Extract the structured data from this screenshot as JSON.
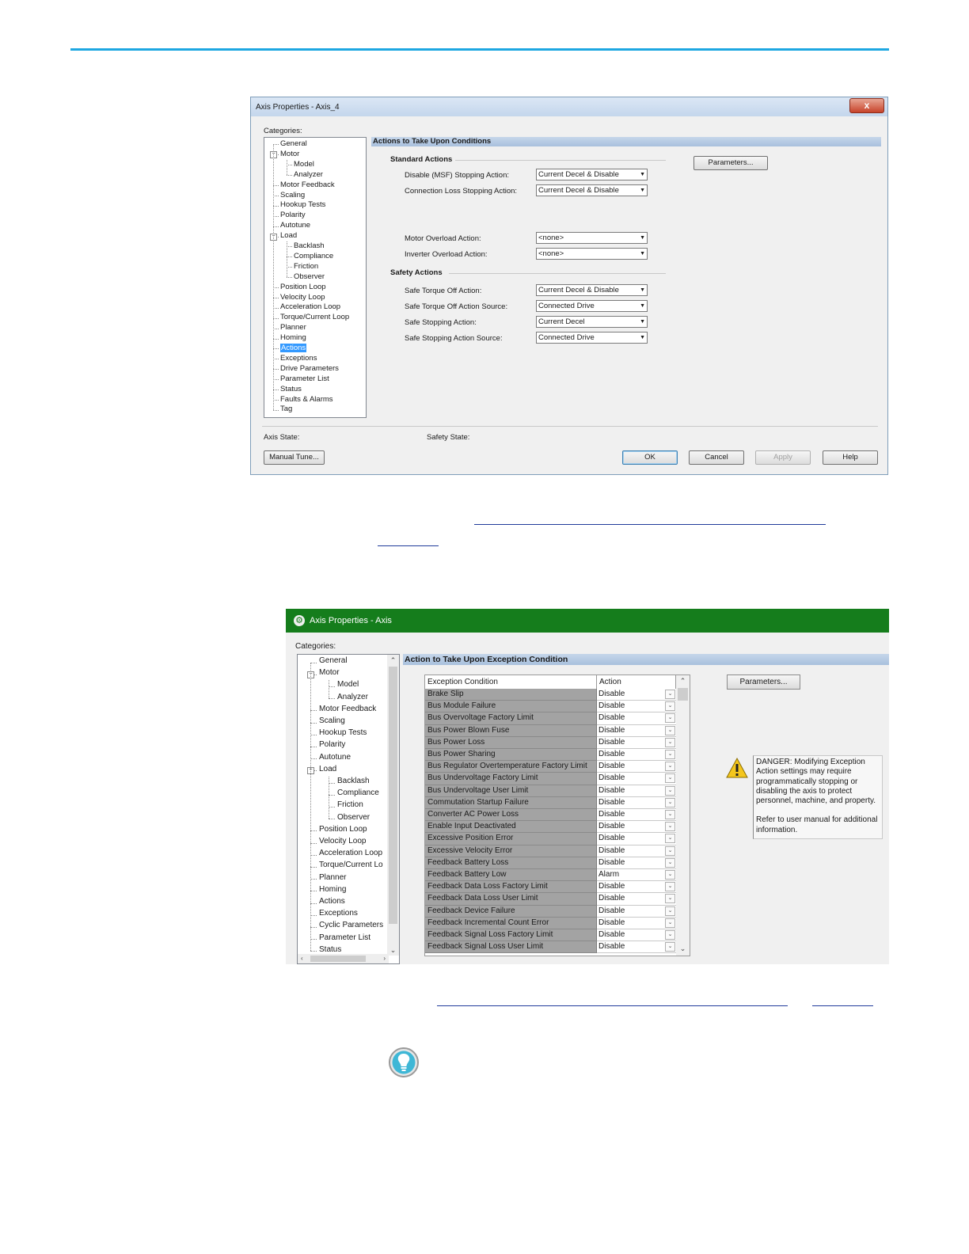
{
  "dialog1": {
    "title": "Axis Properties - Axis_4",
    "close_label": "x",
    "categories_label": "Categories:",
    "tree": [
      "General",
      "Motor",
      "Model",
      "Analyzer",
      "Motor Feedback",
      "Scaling",
      "Hookup Tests",
      "Polarity",
      "Autotune",
      "Load",
      "Backlash",
      "Compliance",
      "Friction",
      "Observer",
      "Position Loop",
      "Velocity Loop",
      "Acceleration Loop",
      "Torque/Current Loop",
      "Planner",
      "Homing",
      "Actions",
      "Exceptions",
      "Drive Parameters",
      "Parameter List",
      "Status",
      "Faults & Alarms",
      "Tag"
    ],
    "selected_item": "Actions",
    "header": "Actions to Take Upon Conditions",
    "standard_actions_label": "Standard Actions",
    "safety_actions_label": "Safety Actions",
    "parameters_button": "Parameters...",
    "fields": [
      {
        "label": "Disable (MSF) Stopping Action:",
        "value": "Current Decel & Disable"
      },
      {
        "label": "Connection Loss Stopping Action:",
        "value": "Current Decel & Disable"
      },
      {
        "label": "Motor Overload Action:",
        "value": "<none>"
      },
      {
        "label": "Inverter Overload Action:",
        "value": "<none>"
      },
      {
        "label": "Safe Torque Off Action:",
        "value": "Current Decel & Disable"
      },
      {
        "label": "Safe Torque Off Action Source:",
        "value": "Connected Drive"
      },
      {
        "label": "Safe Stopping Action:",
        "value": "Current Decel"
      },
      {
        "label": "Safe Stopping Action Source:",
        "value": "Connected Drive"
      }
    ],
    "axis_state_label": "Axis State:",
    "safety_state_label": "Safety State:",
    "buttons": {
      "manual_tune": "Manual Tune...",
      "ok": "OK",
      "cancel": "Cancel",
      "apply": "Apply",
      "help": "Help"
    }
  },
  "dialog2": {
    "title": "Axis Properties - Axis",
    "categories_label": "Categories:",
    "tree": [
      "General",
      "Motor",
      "Model",
      "Analyzer",
      "Motor Feedback",
      "Scaling",
      "Hookup Tests",
      "Polarity",
      "Autotune",
      "Load",
      "Backlash",
      "Compliance",
      "Friction",
      "Observer",
      "Position Loop",
      "Velocity Loop",
      "Acceleration Loop",
      "Torque/Current Lo",
      "Planner",
      "Homing",
      "Actions",
      "Exceptions",
      "Cyclic Parameters",
      "Parameter List",
      "Status"
    ],
    "header": "Action to Take Upon Exception Condition",
    "columns": {
      "condition": "Exception Condition",
      "action": "Action"
    },
    "rows": [
      {
        "condition": "Brake Slip",
        "action": "Disable"
      },
      {
        "condition": "Bus Module Failure",
        "action": "Disable"
      },
      {
        "condition": "Bus Overvoltage Factory Limit",
        "action": "Disable"
      },
      {
        "condition": "Bus Power Blown Fuse",
        "action": "Disable"
      },
      {
        "condition": "Bus Power Loss",
        "action": "Disable"
      },
      {
        "condition": "Bus Power Sharing",
        "action": "Disable"
      },
      {
        "condition": "Bus Regulator Overtemperature Factory Limit",
        "action": "Disable"
      },
      {
        "condition": "Bus Undervoltage Factory Limit",
        "action": "Disable"
      },
      {
        "condition": "Bus Undervoltage User Limit",
        "action": "Disable"
      },
      {
        "condition": "Commutation Startup Failure",
        "action": "Disable"
      },
      {
        "condition": "Converter AC Power Loss",
        "action": "Disable"
      },
      {
        "condition": "Enable Input Deactivated",
        "action": "Disable"
      },
      {
        "condition": "Excessive Position Error",
        "action": "Disable"
      },
      {
        "condition": "Excessive Velocity Error",
        "action": "Disable"
      },
      {
        "condition": "Feedback Battery Loss",
        "action": "Disable"
      },
      {
        "condition": "Feedback Battery Low",
        "action": "Alarm"
      },
      {
        "condition": "Feedback Data Loss Factory Limit",
        "action": "Disable"
      },
      {
        "condition": "Feedback Data Loss User Limit",
        "action": "Disable"
      },
      {
        "condition": "Feedback Device Failure",
        "action": "Disable"
      },
      {
        "condition": "Feedback Incremental Count Error",
        "action": "Disable"
      },
      {
        "condition": "Feedback Signal Loss Factory Limit",
        "action": "Disable"
      },
      {
        "condition": "Feedback Signal Loss User Limit",
        "action": "Disable"
      }
    ],
    "parameters_button": "Parameters...",
    "danger_text": "DANGER: Modifying Exception Action settings may require programmatically stopping or disabling the axis to protect personnel, machine, and property.",
    "refer_text": "Refer to user manual for additional information."
  },
  "colors": {
    "accent_line": "#1ea7e1",
    "green_titlebar": "#157d1c",
    "selection": "#3399ff"
  },
  "icons": {
    "warning": "warning-triangle-icon",
    "tip": "lightbulb-icon"
  }
}
